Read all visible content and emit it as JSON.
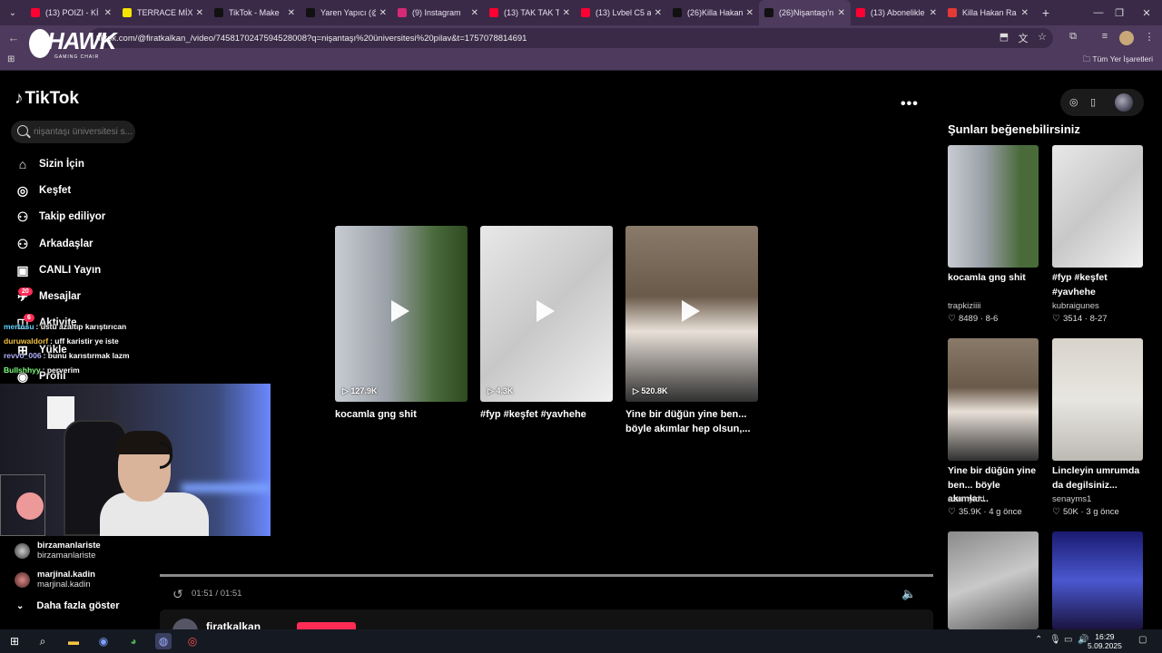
{
  "browser": {
    "tabs": [
      {
        "title": "(13) POIZI - Kİ",
        "fav": "#ff0033"
      },
      {
        "title": "TERRACE MİX",
        "fav": "#f5e400"
      },
      {
        "title": "TikTok - Make",
        "fav": "#111111"
      },
      {
        "title": "Yaren Yapıcı (@",
        "fav": "#111111"
      },
      {
        "title": "(9) Instagram",
        "fav": "#d62976"
      },
      {
        "title": "(13) TAK TAK T",
        "fav": "#ff0033"
      },
      {
        "title": "(13) Lvbel C5 a",
        "fav": "#ff0033"
      },
      {
        "title": "(26)Killa Hakan",
        "fav": "#111111"
      },
      {
        "title": "(26)Nişantaşı'n",
        "fav": "#111111"
      },
      {
        "title": "(13) Abonelikle",
        "fav": "#ff0033"
      },
      {
        "title": "Killa Hakan Ra",
        "fav": "#e53935"
      }
    ],
    "active_tab_index": 8,
    "url": "tiktok.com/@firatkalkan_/video/7458170247594528008?q=nişantaşı%20üniversitesi%20pilav&t=1757078814691",
    "bookmarks_label": "Tüm Yer İşaretleri"
  },
  "overlay": {
    "logo_word": "HAWK",
    "logo_sub": "GAMING CHAIR",
    "chat": [
      {
        "user": "mertosu",
        "text": ": üstü azaltıp karıştırıcan",
        "color": "#5fd3ff"
      },
      {
        "user": "duruwaldorf",
        "text": ": uff karistir ye iste",
        "color": "#f0c040"
      },
      {
        "user": "revvo_006",
        "text": ": bunu karıstırmak lazm",
        "color": "#b0b0ff"
      },
      {
        "user": "Bullshhyy",
        "text": ": perverim",
        "color": "#7fff7f"
      }
    ]
  },
  "sidebar": {
    "logo": "TikTok",
    "search_placeholder": "nişantaşı üniversitesi s...",
    "items": [
      {
        "label": "Sizin İçin",
        "icon": "home-icon",
        "glyph": "⌂"
      },
      {
        "label": "Keşfet",
        "icon": "compass-icon",
        "glyph": "◎"
      },
      {
        "label": "Takip ediliyor",
        "icon": "following-icon",
        "glyph": "⚇"
      },
      {
        "label": "Arkadaşlar",
        "icon": "friends-icon",
        "glyph": "⚇"
      },
      {
        "label": "CANLI Yayın",
        "icon": "live-icon",
        "glyph": "▣"
      },
      {
        "label": "Mesajlar",
        "icon": "messages-icon",
        "glyph": "✈"
      },
      {
        "label": "Aktivite",
        "icon": "activity-icon",
        "glyph": "◫"
      },
      {
        "label": "Yükle",
        "icon": "upload-icon",
        "glyph": "⊞"
      },
      {
        "label": "Profil",
        "icon": "profile-icon",
        "glyph": "◉"
      }
    ],
    "messages_badge": "20",
    "activity_badge": "6",
    "following_accounts": [
      {
        "name": "birzamanlariste",
        "handle": "birzamanlariste"
      },
      {
        "name": "marjinal.kadin",
        "handle": "marjinal.kadin"
      }
    ],
    "more_label": "Daha fazla göster"
  },
  "main": {
    "videos": [
      {
        "views": "127.9K",
        "title": "kocamla gng shit"
      },
      {
        "views": "4.3K",
        "title": "#fyp #keşfet #yavhehe"
      },
      {
        "views": "520.8K",
        "title": "Yine bir düğün yine ben... böyle akımlar hep olsun,..."
      }
    ],
    "timecode": "01:51 / 01:51",
    "progress": 1.0,
    "author": "firatkalkan_"
  },
  "right": {
    "title": "Şunları beğenebilirsiniz",
    "cards": [
      {
        "title": "kocamla gng shit",
        "author": "trapkiziiii",
        "likes": "8489",
        "date": "8-6"
      },
      {
        "title": "#fyp #keşfet #yavhehe",
        "author": "kubraigunes",
        "likes": "3514",
        "date": "8-27"
      },
      {
        "title": "Yine bir düğün yine ben... böyle akımlar...",
        "author": "ozumyldd",
        "likes": "35.9K",
        "date": "4 g önce"
      },
      {
        "title": "Lincleyin umrumda da degilsiniz...",
        "author": "senayms1",
        "likes": "50K",
        "date": "3 g önce"
      }
    ]
  },
  "taskbar": {
    "time": "16:29",
    "date": "5.09.2025"
  }
}
